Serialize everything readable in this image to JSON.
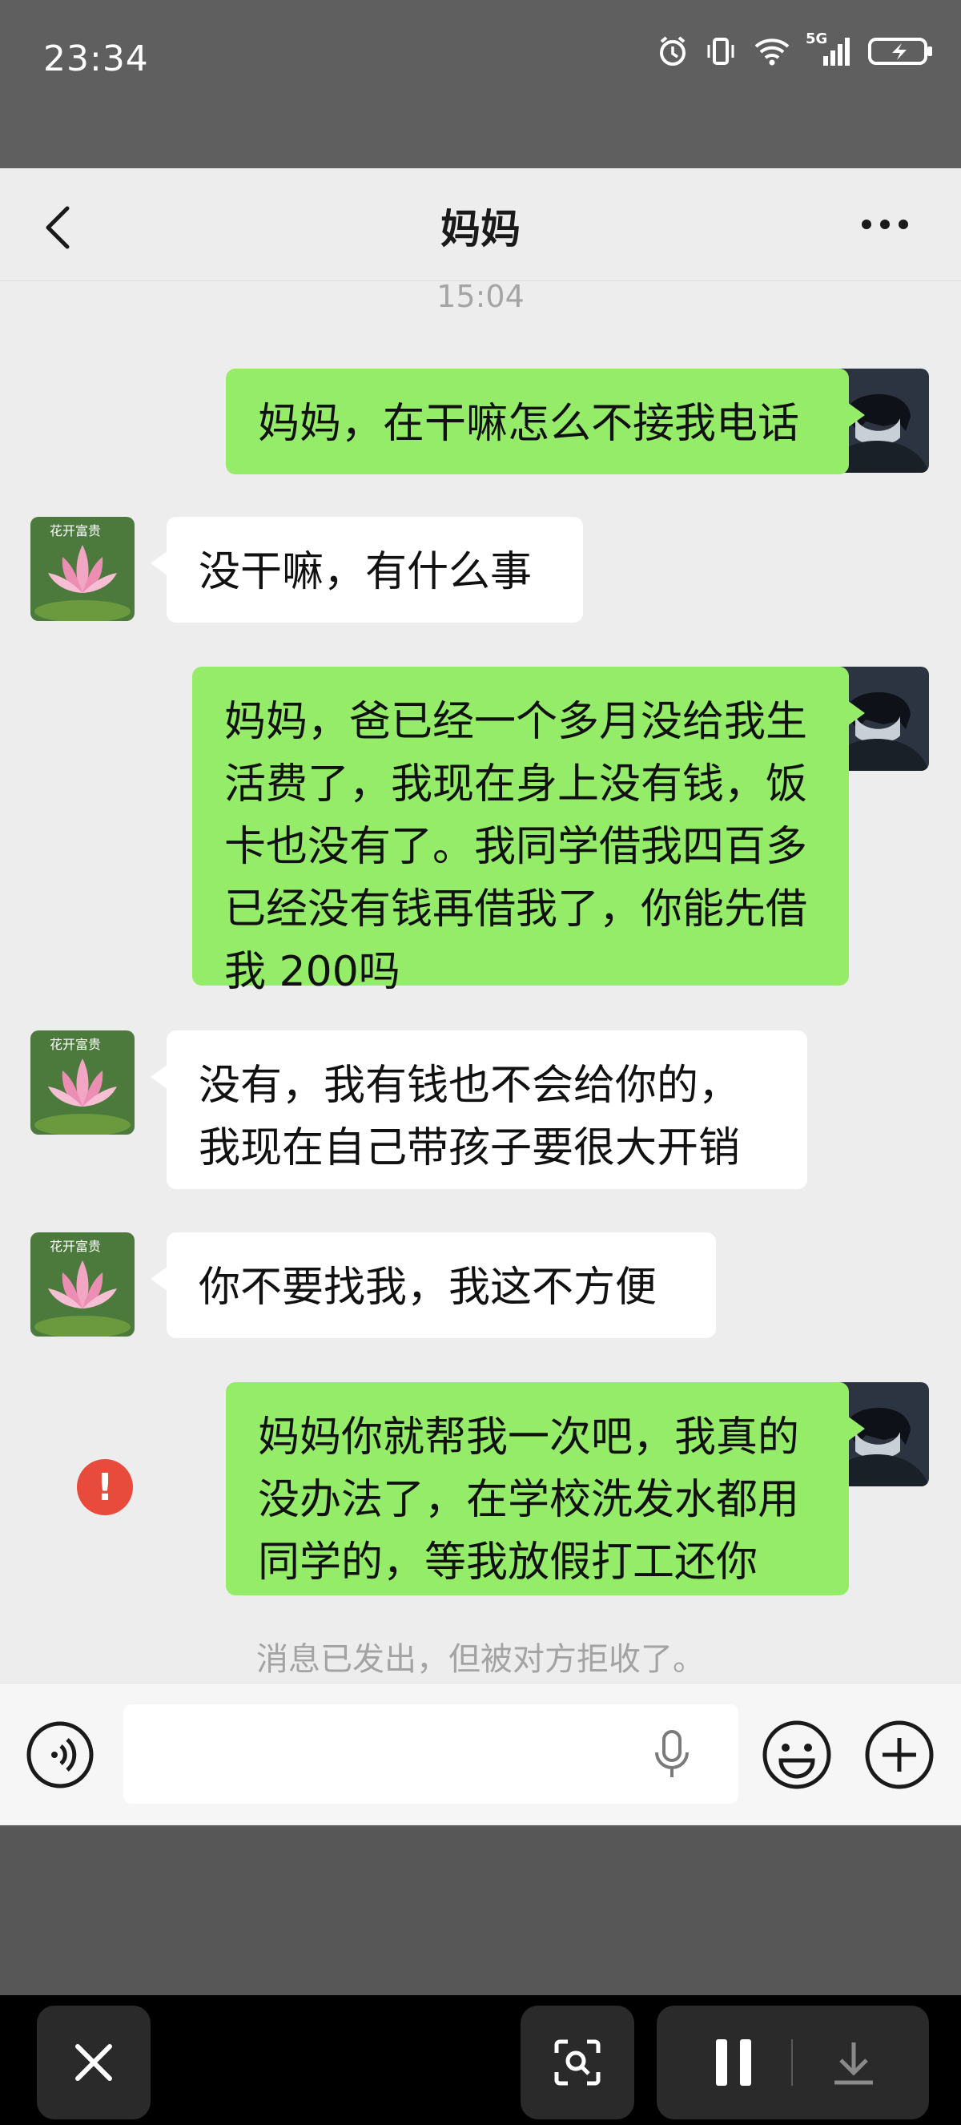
{
  "status_bar": {
    "time": "23:34",
    "network": "5G"
  },
  "chat": {
    "title": "妈妈",
    "timestamp": "15:04",
    "messages": [
      {
        "from": "me",
        "text": "妈妈，在干嘛怎么不接我电话"
      },
      {
        "from": "them",
        "text": "没干嘛，有什么事"
      },
      {
        "from": "me",
        "text": "妈妈，爸已经一个多月没给我生活费了，我现在身上没有钱，饭卡也没有了。我同学借我四百多已经没有钱再借我了，你能先借我 200吗"
      },
      {
        "from": "them",
        "text": "没有，我有钱也不会给你的，我现在自己带孩子要很大开销"
      },
      {
        "from": "them",
        "text": "你不要找我，我这不方便"
      },
      {
        "from": "me",
        "text": "妈妈你就帮我一次吧，我真的没办法了，在学校洗发水都用同学的，等我放假打工还你",
        "failed": true
      }
    ],
    "system_note": "消息已发出，但被对方拒收了。",
    "error_mark": "!",
    "them_avatar_caption": "花开富贵"
  },
  "colors": {
    "my_bubble": "#95ec69",
    "their_bubble": "#ffffff",
    "error": "#e84a3c"
  },
  "icons": [
    "back-icon",
    "more-icon",
    "voice-icon",
    "mic-icon",
    "emoji-icon",
    "plus-icon",
    "close-icon",
    "scan-icon",
    "pause-icon",
    "download-icon"
  ]
}
